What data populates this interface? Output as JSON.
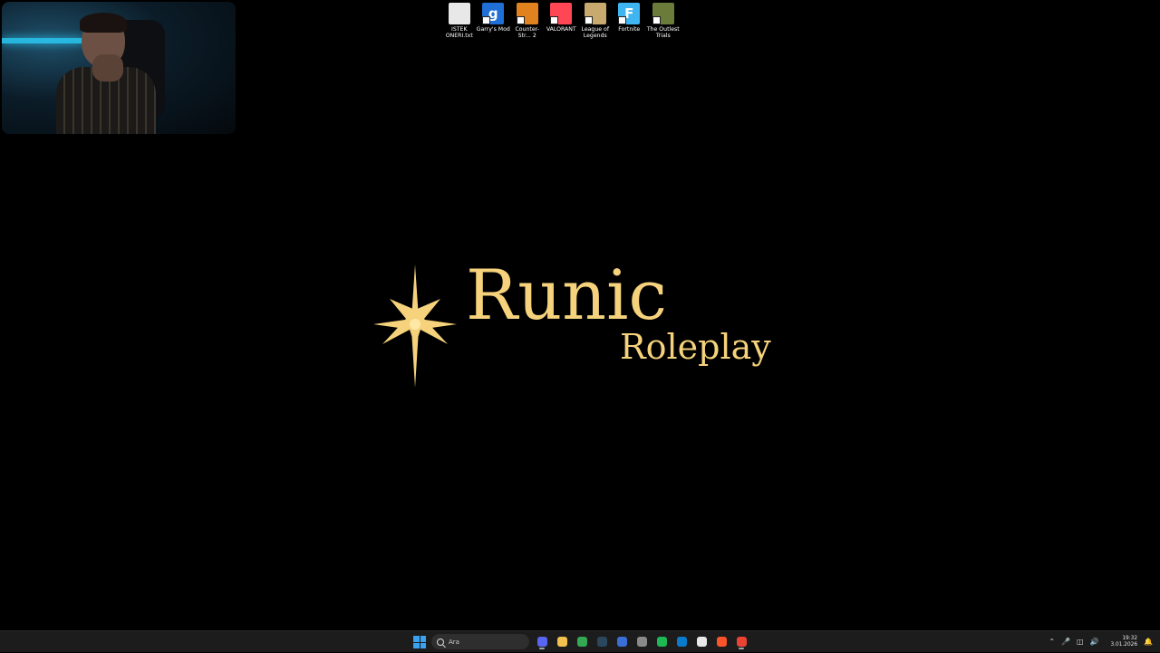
{
  "desktop_icons": [
    {
      "label": "ISTEK ONERI.txt",
      "icon": "text-file-icon",
      "color": "#e8e8e8",
      "glyph": ""
    },
    {
      "label": "Garry's Mod",
      "icon": "garrys-mod-icon",
      "color": "#1f6fd6",
      "glyph": "g"
    },
    {
      "label": "Counter-Str... 2",
      "icon": "counter-strike-icon",
      "color": "#e0821e",
      "glyph": ""
    },
    {
      "label": "VALORANT",
      "icon": "valorant-icon",
      "color": "#ff4655",
      "glyph": ""
    },
    {
      "label": "League of Legends",
      "icon": "league-of-legends-icon",
      "color": "#c8aa6e",
      "glyph": ""
    },
    {
      "label": "Fortnite",
      "icon": "fortnite-icon",
      "color": "#3fb6f2",
      "glyph": "F"
    },
    {
      "label": "The Outlest Trials",
      "icon": "outlast-trials-icon",
      "color": "#6b7b3a",
      "glyph": ""
    }
  ],
  "logo": {
    "title": "Runic",
    "subtitle": "Roleplay",
    "color": "#f5d27b",
    "icon": "compass-star-icon"
  },
  "taskbar": {
    "search_placeholder": "Ara",
    "apps": [
      {
        "name": "discord",
        "color": "#5865f2",
        "active": true
      },
      {
        "name": "file-explorer",
        "color": "#f2c14e",
        "active": false
      },
      {
        "name": "chrome",
        "color": "#34a853",
        "active": false
      },
      {
        "name": "steam",
        "color": "#2a475e",
        "active": false
      },
      {
        "name": "app-blue",
        "color": "#3b6fd6",
        "active": false
      },
      {
        "name": "settings",
        "color": "#8a8a8a",
        "active": false
      },
      {
        "name": "spotify",
        "color": "#1db954",
        "active": false
      },
      {
        "name": "vscode",
        "color": "#0a7acc",
        "active": false
      },
      {
        "name": "notion",
        "color": "#e9e9e9",
        "active": false
      },
      {
        "name": "brave",
        "color": "#fb542b",
        "active": false
      },
      {
        "name": "chrome-profile",
        "color": "#ea4335",
        "active": true
      }
    ],
    "clock_time": "19:32",
    "clock_date": "3.01.2026"
  }
}
